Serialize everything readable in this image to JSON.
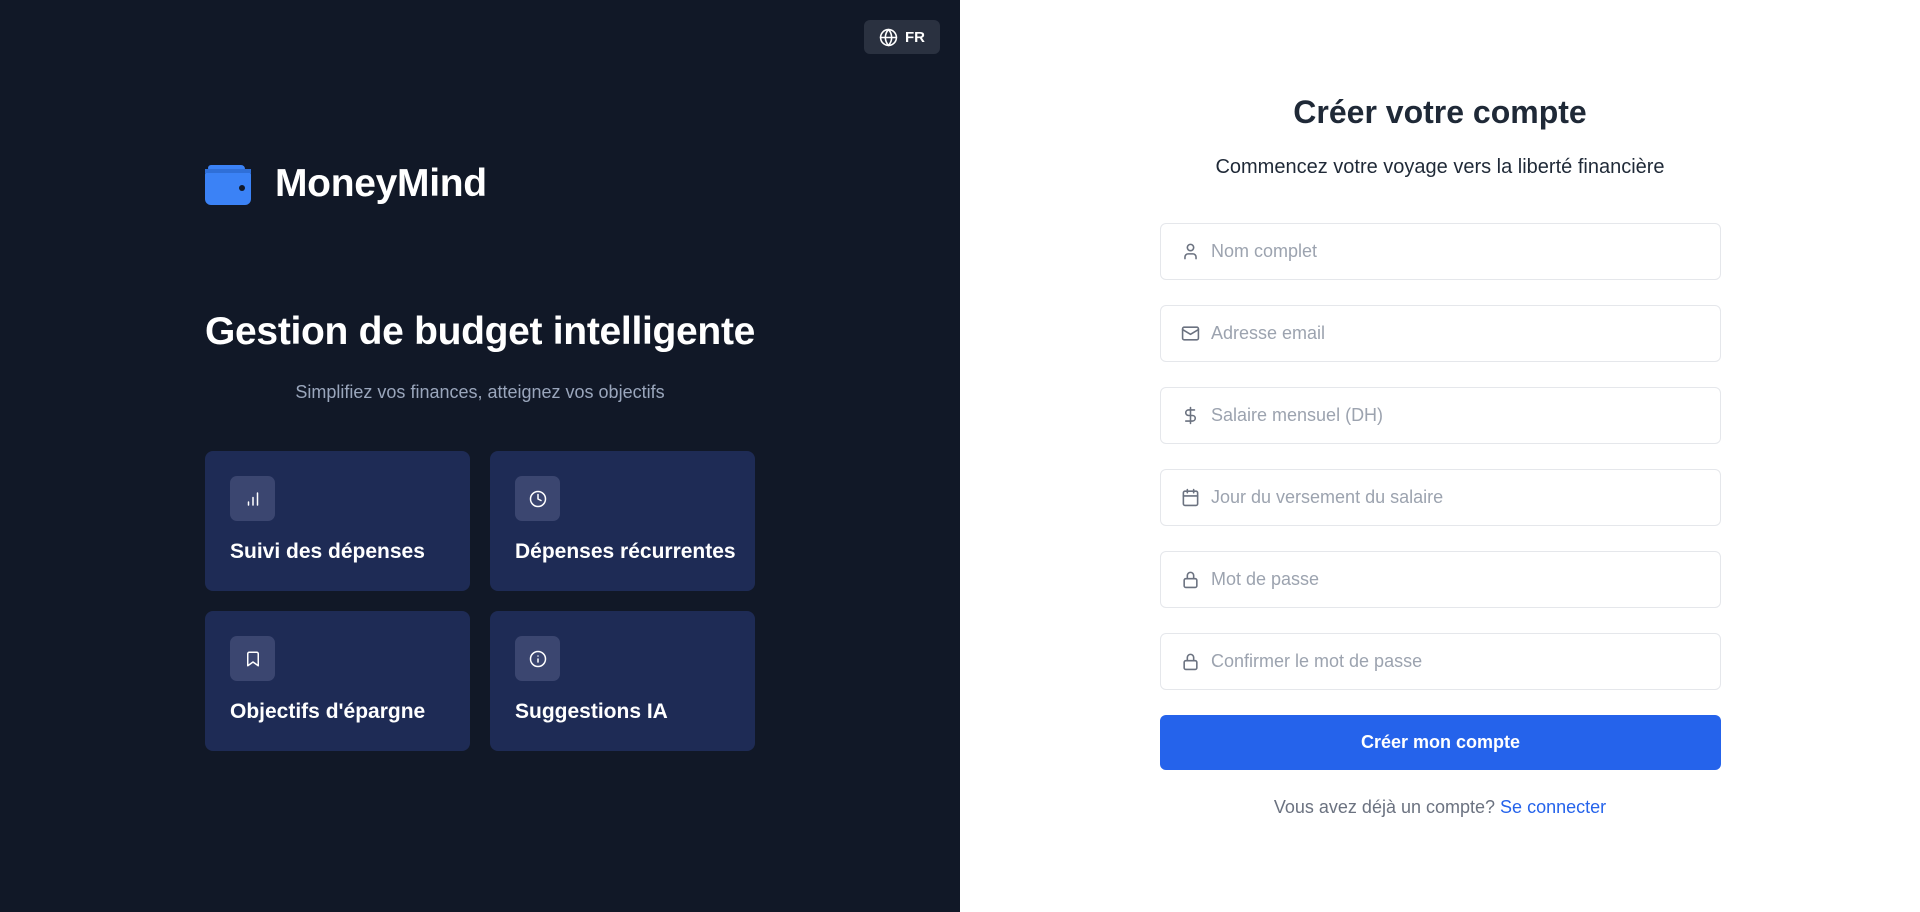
{
  "language": {
    "label": "FR",
    "icon": "globe-icon"
  },
  "brand": {
    "name": "MoneyMind",
    "icon": "wallet-icon",
    "accent": "#3b82f6"
  },
  "hero": {
    "title": "Gestion de budget intelligente",
    "subtitle": "Simplifiez vos finances, atteignez vos objectifs"
  },
  "features": [
    {
      "label": "Suivi des dépenses",
      "icon": "bar-chart-icon"
    },
    {
      "label": "Dépenses récurrentes",
      "icon": "clock-icon"
    },
    {
      "label": "Objectifs d'épargne",
      "icon": "bookmark-icon"
    },
    {
      "label": "Suggestions IA",
      "icon": "info-icon"
    }
  ],
  "form": {
    "title": "Créer votre compte",
    "subtitle": "Commencez votre voyage vers la liberté financière",
    "fields": {
      "name": {
        "placeholder": "Nom complet",
        "value": "",
        "icon": "user-icon"
      },
      "email": {
        "placeholder": "Adresse email",
        "value": "",
        "icon": "mail-icon"
      },
      "salary": {
        "placeholder": "Salaire mensuel (DH)",
        "value": "",
        "icon": "dollar-icon"
      },
      "payday": {
        "placeholder": "Jour du versement du salaire",
        "value": "",
        "icon": "calendar-icon"
      },
      "password": {
        "placeholder": "Mot de passe",
        "value": "",
        "icon": "lock-icon"
      },
      "confirm": {
        "placeholder": "Confirmer le mot de passe",
        "value": "",
        "icon": "lock-icon"
      }
    },
    "submit_label": "Créer mon compte",
    "login_prompt": "Vous avez déjà un compte?",
    "login_link": "Se connecter"
  },
  "colors": {
    "left_bg": "#111827",
    "card_bg": "#1e2b55",
    "primary": "#2563eb"
  }
}
